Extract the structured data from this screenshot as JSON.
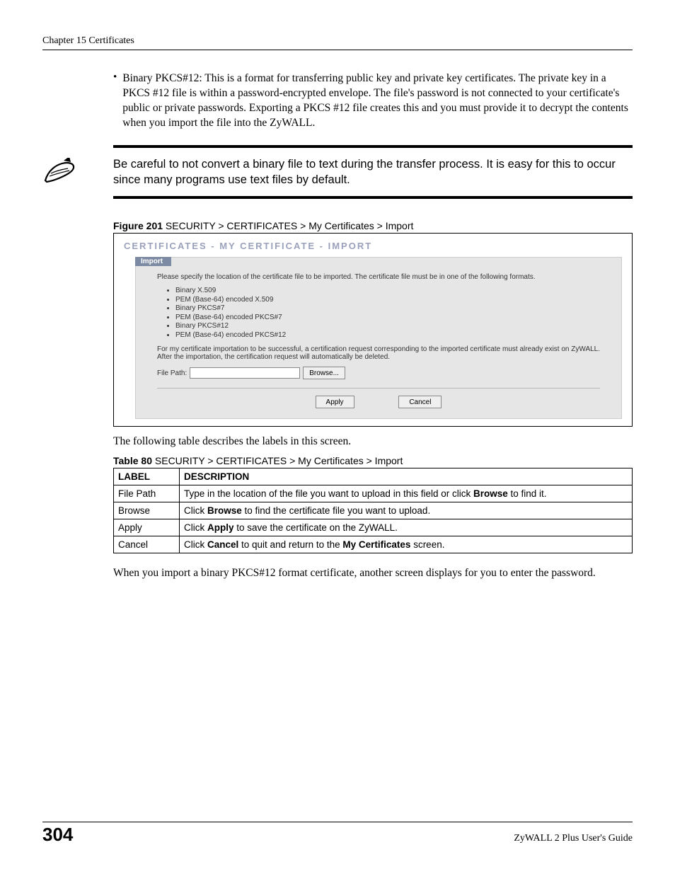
{
  "header": {
    "chapter": "Chapter 15 Certificates"
  },
  "bullet": {
    "label": "Binary PKCS#12:",
    "text": " This is a format for transferring public key and private key certificates. The private key in a PKCS #12 file is within a password-encrypted envelope. The file's password is not connected to your certificate's public or private passwords. Exporting a PKCS #12 file creates this and you must provide it to decrypt the contents when you import the file into the ZyWALL."
  },
  "note": "Be careful to not convert a binary file to text during the transfer process. It is easy for this to occur since many programs use text files by default.",
  "figure": {
    "num": "Figure 201",
    "caption": "   SECURITY > CERTIFICATES > My Certificates > Import",
    "title": "CERTIFICATES - MY CERTIFICATE - IMPORT"
  },
  "import": {
    "tab": "Import",
    "intro": "Please specify the location of the certificate file to be imported. The certificate file must be in one of the following formats.",
    "formats": [
      "Binary X.509",
      "PEM (Base-64) encoded X.509",
      "Binary PKCS#7",
      "PEM (Base-64) encoded PKCS#7",
      "Binary PKCS#12",
      "PEM (Base-64) encoded PKCS#12"
    ],
    "note": "For my certificate importation to be successful, a certification request corresponding to the imported certificate must already exist on ZyWALL. After the importation, the certification request will automatically be deleted.",
    "filePathLabel": "File Path:",
    "browse": "Browse...",
    "apply": "Apply",
    "cancel": "Cancel"
  },
  "afterFigure": "The following table describes the labels in this screen.",
  "table": {
    "num": "Table 80",
    "caption": "   SECURITY > CERTIFICATES > My Certificates > Import",
    "headers": {
      "label": "LABEL",
      "desc": "DESCRIPTION"
    },
    "rows": [
      {
        "label": "File Path",
        "pre": "Type in the location of the file you want to upload in this field or click ",
        "bold": "Browse",
        "post": " to find it."
      },
      {
        "label": "Browse",
        "pre": "Click ",
        "bold": "Browse",
        "post": " to find the certificate file you want to upload."
      },
      {
        "label": "Apply",
        "pre": "Click ",
        "bold": "Apply",
        "post": " to save the certificate on the ZyWALL."
      },
      {
        "label": "Cancel",
        "pre": "Click ",
        "bold": "Cancel",
        "post": " to quit and return to the ",
        "bold2": "My Certificates",
        "post2": " screen."
      }
    ]
  },
  "closing": "When you import a binary PKCS#12 format certificate, another screen displays for you to enter the password.",
  "footer": {
    "page": "304",
    "guide": "ZyWALL 2 Plus User's Guide"
  }
}
